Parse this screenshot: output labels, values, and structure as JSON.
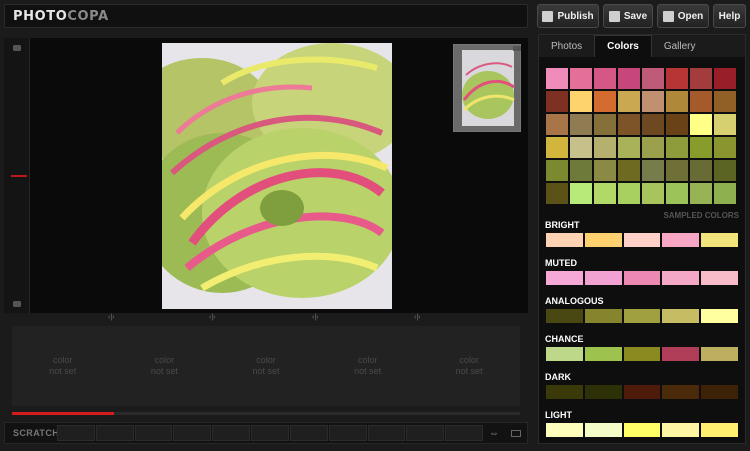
{
  "app": {
    "logo_part1": "PHOTO",
    "logo_part2": "COPA"
  },
  "toolbar": [
    {
      "label": "Publish",
      "icon": "publish-icon"
    },
    {
      "label": "Save",
      "icon": "save-icon"
    },
    {
      "label": "Open",
      "icon": "open-icon"
    },
    {
      "label": "Help",
      "icon": ""
    }
  ],
  "slots": [
    {
      "line1": "color",
      "line2": "not set"
    },
    {
      "line1": "color",
      "line2": "not set"
    },
    {
      "line1": "color",
      "line2": "not set"
    },
    {
      "line1": "color",
      "line2": "not set"
    },
    {
      "line1": "color",
      "line2": "not set"
    }
  ],
  "progress": {
    "fraction": 0.2
  },
  "scratch": {
    "label": "SCRATCH",
    "cells": 11
  },
  "tabs": [
    {
      "label": "Photos",
      "active": false
    },
    {
      "label": "Colors",
      "active": true
    },
    {
      "label": "Gallery",
      "active": false
    }
  ],
  "sampled": {
    "caption": "SAMPLED COLORS",
    "colors": [
      "#f08cbc",
      "#e46f98",
      "#d55785",
      "#c8477a",
      "#bf5b78",
      "#b83535",
      "#a33d3d",
      "#981e2a",
      "#7e3022",
      "#ffd36c",
      "#d46c30",
      "#c9a84f",
      "#c09070",
      "#b0883a",
      "#a45a2a",
      "#906026",
      "#a87548",
      "#8f7c52",
      "#86703a",
      "#7c5428",
      "#6e4820",
      "#6a4218",
      "#ffff88",
      "#d6d070",
      "#d2b53d",
      "#c7c08b",
      "#b5b06d",
      "#aab259",
      "#9aa04b",
      "#8f9c3c",
      "#889c2c",
      "#8a9530",
      "#7b8a2e",
      "#6e7a3a",
      "#8a8a44",
      "#6e6a22",
      "#767c4a",
      "#6e7038",
      "#686c34",
      "#5c6424",
      "#5a5216",
      "#b8ea7a",
      "#b2d968",
      "#a8d060",
      "#a8c45c",
      "#9cc25a",
      "#96b454",
      "#8eb04e"
    ]
  },
  "palettes": [
    {
      "name": "BRIGHT",
      "colors": [
        "#ffd2b4",
        "#ffd070",
        "#ffd0c8",
        "#f8a6c4",
        "#f2e47a"
      ]
    },
    {
      "name": "MUTED",
      "colors": [
        "#f6a8d6",
        "#f2a2d2",
        "#ec88b2",
        "#f4a8c6",
        "#f8bcc8"
      ]
    },
    {
      "name": "ANALOGOUS",
      "colors": [
        "#4a4812",
        "#86842c",
        "#a0a040",
        "#c6bc64",
        "#ffffa0"
      ]
    },
    {
      "name": "CHANCE",
      "colors": [
        "#bcd888",
        "#9ec24e",
        "#8a8a20",
        "#b03e58",
        "#bcb060"
      ]
    },
    {
      "name": "DARK",
      "colors": [
        "#3a3a08",
        "#2e3008",
        "#4e1a0a",
        "#4a2a08",
        "#3e2208"
      ]
    },
    {
      "name": "LIGHT",
      "colors": [
        "#ffffbc",
        "#f6fcc8",
        "#ffff66",
        "#fff6a4",
        "#fff070"
      ]
    }
  ]
}
